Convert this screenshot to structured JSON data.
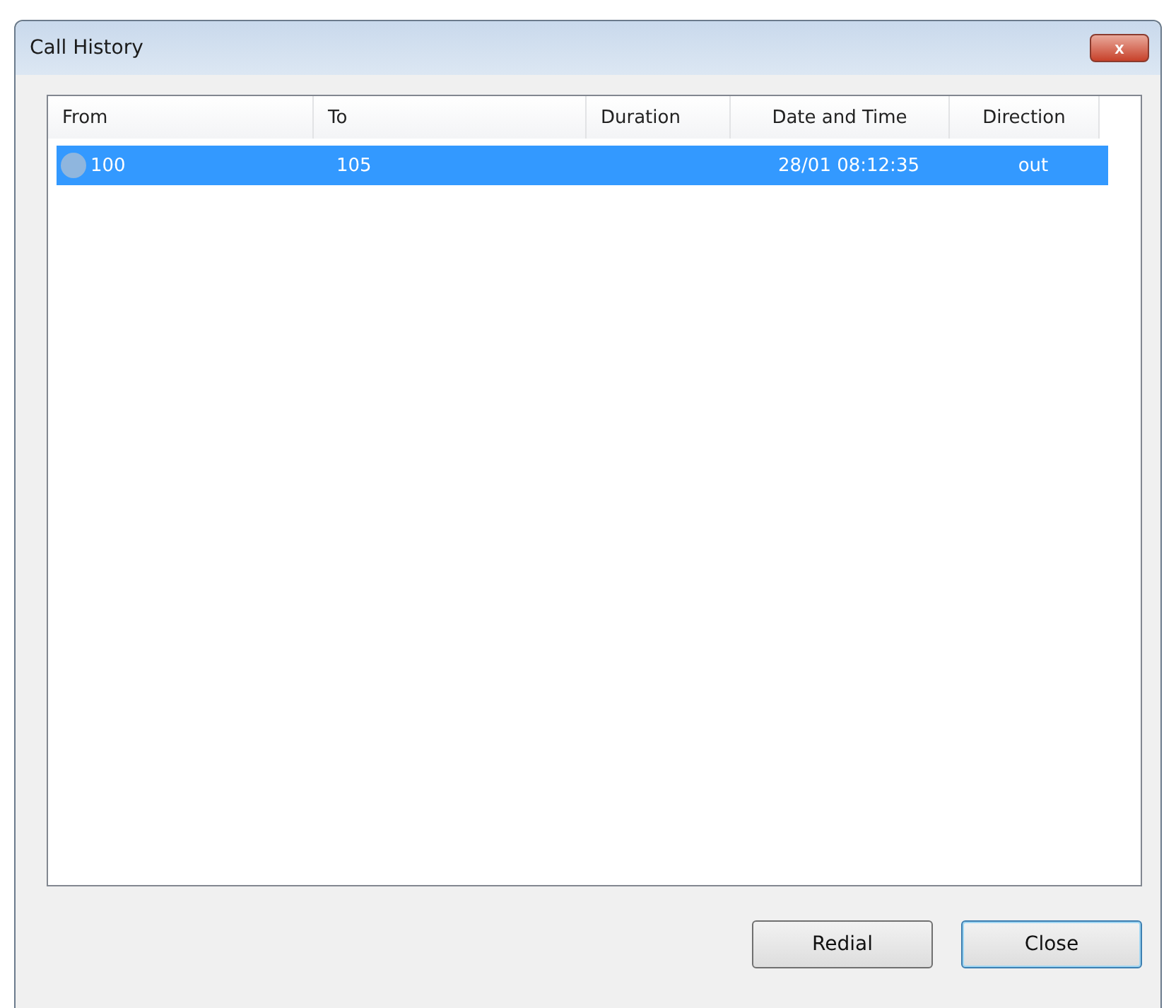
{
  "window": {
    "title": "Call History",
    "close_label": "x"
  },
  "table": {
    "columns": [
      "From",
      "To",
      "Duration",
      "Date and Time",
      "Direction"
    ],
    "rows": [
      {
        "from": "100",
        "to": "105",
        "duration": "",
        "datetime": "28/01 08:12:35",
        "direction": "out",
        "selected": true
      }
    ]
  },
  "buttons": [
    {
      "label": "Redial",
      "default": false
    },
    {
      "label": "Close",
      "default": true
    }
  ]
}
